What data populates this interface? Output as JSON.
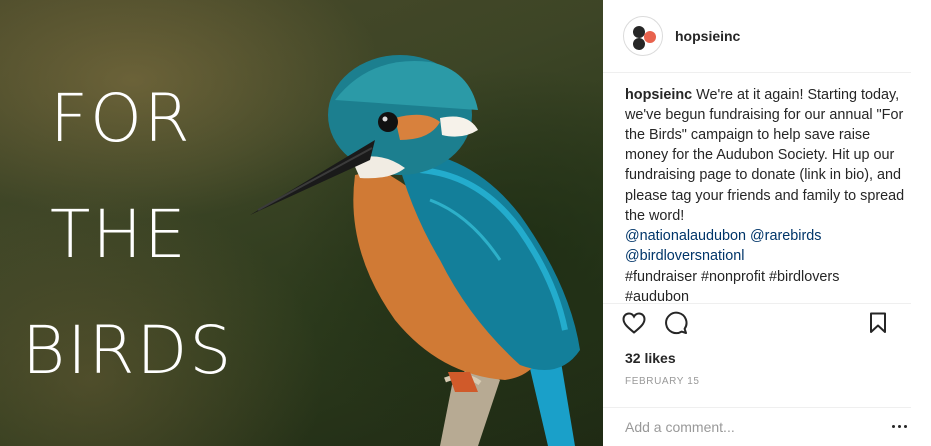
{
  "post": {
    "image": {
      "overlay_lines": [
        "FOR",
        "THE",
        "BIRDS"
      ]
    },
    "header": {
      "username": "hopsieinc"
    },
    "caption": {
      "username": "hopsieinc",
      "text": "We're at it again! Starting today, we've begun fundraising for our annual \"For the Birds\" campaign to help save raise money for the Audubon Society. Hit up our fundraising page to donate (link in bio), and please tag your friends and family to spread the word!",
      "mentions": [
        "@nationalaudubon",
        "@rarebirds",
        "@birdloversnationl"
      ],
      "hashtags": [
        "#fundraiser",
        "#nonprofit",
        "#birdlovers",
        "#audubon"
      ]
    },
    "actions": {
      "like_icon": "heart-icon",
      "comment_icon": "speech-bubble-icon",
      "save_icon": "bookmark-icon"
    },
    "likes": "32 likes",
    "date": "FEBRUARY 15",
    "comment": {
      "placeholder": "Add a comment...",
      "more_icon": "more-options-icon"
    },
    "colors": {
      "mention": "#003569",
      "avatar_accent": "#e8624d",
      "divider": "#efefef",
      "muted": "#999999"
    }
  }
}
